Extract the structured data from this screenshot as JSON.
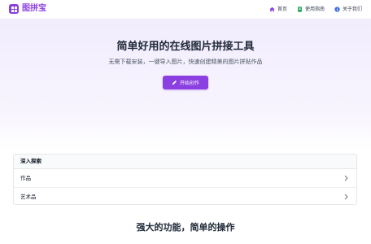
{
  "header": {
    "logo_text": "图拼宝",
    "nav": [
      {
        "label": "首页",
        "icon": "home-icon"
      },
      {
        "label": "使用指南",
        "icon": "book-icon"
      },
      {
        "label": "关于我们",
        "icon": "info-icon"
      }
    ]
  },
  "hero": {
    "title": "简单好用的在线图片拼接工具",
    "subtitle": "无需下载安装，一键导入图片，快速创建精美的图片拼贴作品",
    "cta_label": "开始创作"
  },
  "explore": {
    "heading": "深入探索",
    "items": [
      {
        "label": "作品"
      },
      {
        "label": "艺术品"
      }
    ]
  },
  "features": {
    "title": "强大的功能，简单的操作"
  },
  "colors": {
    "accent": "#8b3fe0",
    "nav_book_icon": "#22a55a",
    "nav_info_icon": "#3b6fe0"
  }
}
